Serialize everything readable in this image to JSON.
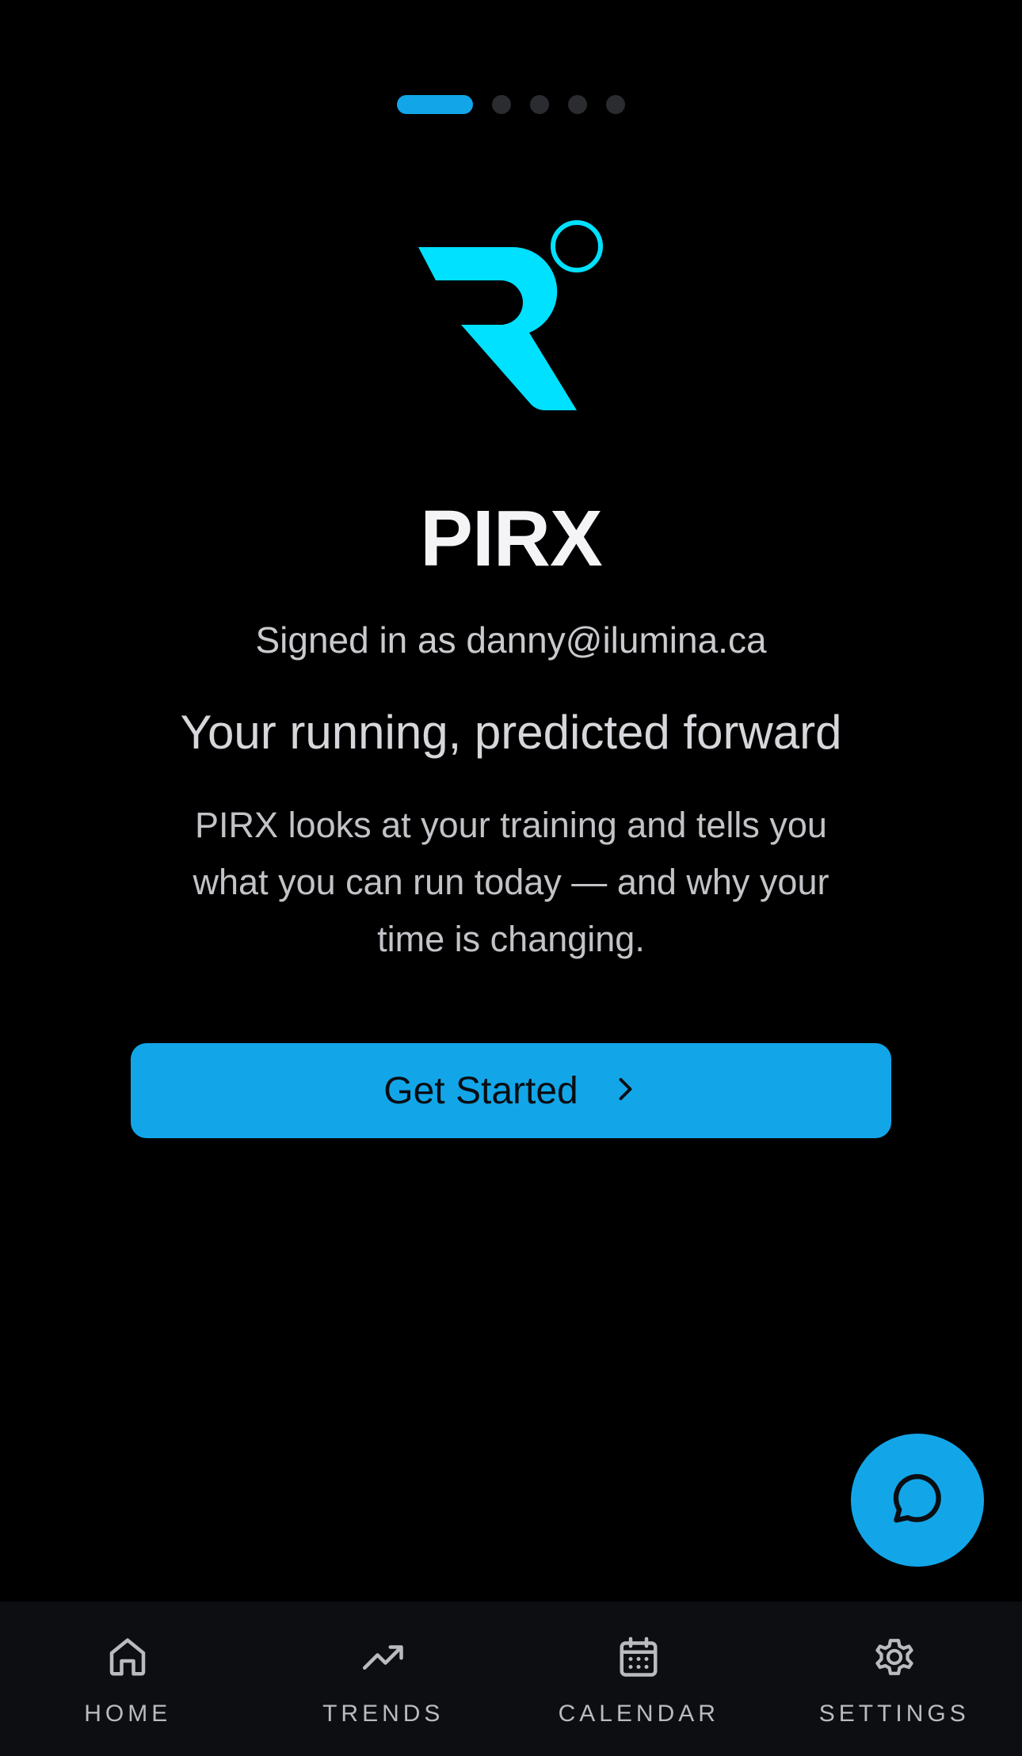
{
  "pager": {
    "total": 5,
    "active_index": 0
  },
  "app": {
    "title": "PIRX",
    "logo_icon": "pirx-runner-logo",
    "signed_in_text": "Signed in as danny@ilumina.ca",
    "headline": "Your running, predicted forward",
    "description": "PIRX looks at your training and tells you what you can run today — and why your time is changing."
  },
  "cta": {
    "label": "Get Started",
    "icon": "chevron-right-icon"
  },
  "fab": {
    "icon": "chat-bubble-icon"
  },
  "tabbar": {
    "items": [
      {
        "label": "HOME",
        "icon": "home-icon"
      },
      {
        "label": "TRENDS",
        "icon": "trend-up-icon"
      },
      {
        "label": "CALENDAR",
        "icon": "calendar-icon"
      },
      {
        "label": "SETTINGS",
        "icon": "gear-icon"
      }
    ]
  },
  "colors": {
    "accent": "#12a6e8",
    "logo": "#00e0ff",
    "background": "#000000",
    "tabbar": "#0d0e11"
  }
}
